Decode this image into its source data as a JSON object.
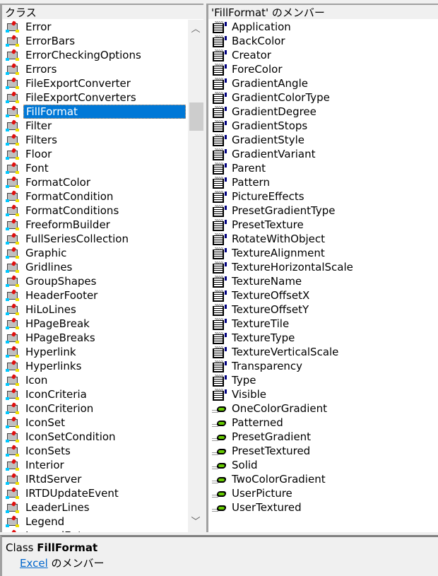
{
  "classes_pane": {
    "header": "クラス",
    "selected": "FillFormat",
    "items": [
      "Error",
      "ErrorBars",
      "ErrorCheckingOptions",
      "Errors",
      "FileExportConverter",
      "FileExportConverters",
      "FillFormat",
      "Filter",
      "Filters",
      "Floor",
      "Font",
      "FormatColor",
      "FormatCondition",
      "FormatConditions",
      "FreeformBuilder",
      "FullSeriesCollection",
      "Graphic",
      "Gridlines",
      "GroupShapes",
      "HeaderFooter",
      "HiLoLines",
      "HPageBreak",
      "HPageBreaks",
      "Hyperlink",
      "Hyperlinks",
      "Icon",
      "IconCriteria",
      "IconCriterion",
      "IconSet",
      "IconSetCondition",
      "IconSets",
      "Interior",
      "IRtdServer",
      "IRTDUpdateEvent",
      "LeaderLines",
      "Legend",
      "LegendEntry"
    ],
    "scroll_up_icon": "chevron-up",
    "scroll_down_icon": "chevron-down"
  },
  "members_pane": {
    "header": "'FillFormat' のメンバー",
    "properties": [
      "Application",
      "BackColor",
      "Creator",
      "ForeColor",
      "GradientAngle",
      "GradientColorType",
      "GradientDegree",
      "GradientStops",
      "GradientStyle",
      "GradientVariant",
      "Parent",
      "Pattern",
      "PictureEffects",
      "PresetGradientType",
      "PresetTexture",
      "RotateWithObject",
      "TextureAlignment",
      "TextureHorizontalScale",
      "TextureName",
      "TextureOffsetX",
      "TextureOffsetY",
      "TextureTile",
      "TextureType",
      "TextureVerticalScale",
      "Transparency",
      "Type",
      "Visible"
    ],
    "methods": [
      "OneColorGradient",
      "Patterned",
      "PresetGradient",
      "PresetTextured",
      "Solid",
      "TwoColorGradient",
      "UserPicture",
      "UserTextured"
    ]
  },
  "details": {
    "kind": "Class",
    "name": "FillFormat",
    "library_link": "Excel",
    "member_of_suffix": " のメンバー"
  },
  "colors": {
    "selection": "#0078d7",
    "link": "#0066cc"
  }
}
